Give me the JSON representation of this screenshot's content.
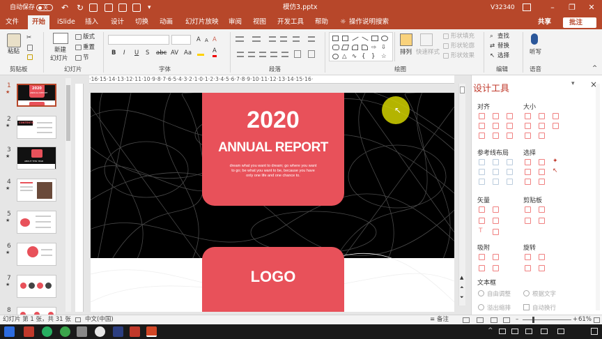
{
  "titlebar": {
    "autosave": "自动保存",
    "autosave_state": "关",
    "filename": "模仿3.pptx",
    "version": "V32340"
  },
  "tabs": [
    "文件",
    "开始",
    "iSlide",
    "插入",
    "设计",
    "切换",
    "动画",
    "幻灯片放映",
    "审阅",
    "视图",
    "开发工具",
    "帮助"
  ],
  "active_tab": "开始",
  "tell_me": "操作说明搜索",
  "share_label": "共享",
  "comment_label": "批注",
  "ribbon": {
    "clipboard": {
      "paste": "粘贴",
      "label": "剪贴板"
    },
    "slides": {
      "new_line1": "新建",
      "new_line2": "幻灯片",
      "layout": "版式",
      "reset": "重置",
      "section": "节",
      "label": "幻灯片"
    },
    "font": {
      "label": "字体",
      "bold": "B",
      "italic": "I",
      "underline": "U",
      "strike": "S",
      "abc": "abc",
      "av": "AV",
      "aa": "Aa",
      "grow": "A",
      "shrink": "A",
      "color_a": "A",
      "clear": "A"
    },
    "paragraph": {
      "label": "段落"
    },
    "drawing": {
      "arrange": "排列",
      "quick_styles": "快速样式",
      "fill": "形状填充",
      "outline": "形状轮廓",
      "effects": "形状效果",
      "label": "绘图"
    },
    "editing": {
      "find": "查找",
      "replace": "替换",
      "select": "选择",
      "label": "编辑"
    },
    "voice": {
      "dictate": "听写",
      "label": "语音"
    }
  },
  "slide_numbers": [
    "1",
    "2",
    "3",
    "4",
    "5",
    "6",
    "7",
    "8"
  ],
  "ruler_text": "·16·15·14·13·12·11·10·9·8·7·6·5·4·3·2·1·0·1·2·3·4·5·6·7·8·9·10·11·12·13·14·15·16·",
  "slide": {
    "year": "2020",
    "headline": "ANNUAL REPORT",
    "body_line1": "dream what you want to dream; go where you want",
    "body_line2": "to go; be what you want to be, because you have",
    "body_line3": "only one life and one chance to.",
    "logo": "LOGO"
  },
  "thumb_texts": {
    "t1_title": "2020",
    "t1_sub": "ANNUAL REPORT",
    "t2_title": "CONTENTS",
    "t3_title": "ABOUT THIS YEAR"
  },
  "design_panel": {
    "title": "设计工具",
    "close": "×",
    "sections": {
      "align": "对齐",
      "size": "大小",
      "guides": "参考线布局",
      "select": "选择",
      "vector": "矢量",
      "clipboard": "剪贴板",
      "snap": "吸附",
      "rotate": "旋转",
      "textbox": "文本框"
    },
    "options": {
      "auto_adjust": "自由调整",
      "fit_text": "根据文字",
      "overflow_shrink": "溢出缩排",
      "auto_wrap": "自动换行"
    }
  },
  "status": {
    "slide_info": "幻灯片 第 1 张，共 31 张",
    "language": "中文(中国)",
    "notes": "备注",
    "zoom": "61%"
  },
  "colors": {
    "accent": "#b7472a",
    "card": "#e8515a",
    "cursor": "#d4d400"
  }
}
